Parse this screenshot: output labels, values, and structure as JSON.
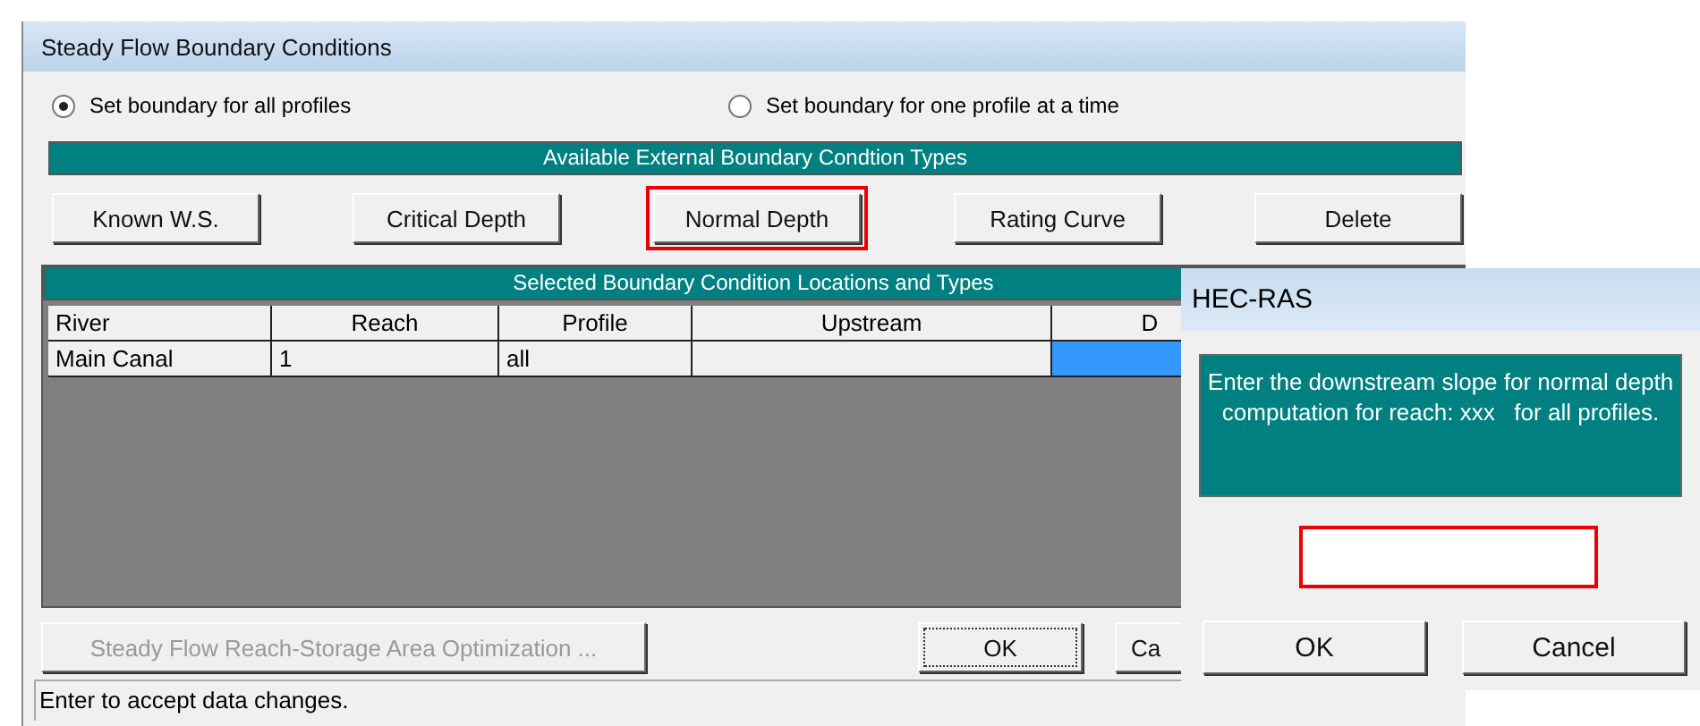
{
  "window": {
    "title": "Steady Flow Boundary Conditions"
  },
  "mode_options": [
    {
      "label": "Set boundary for all profiles",
      "selected": true
    },
    {
      "label": "Set boundary for one profile at a time",
      "selected": false
    }
  ],
  "types_header": "Available External Boundary Condtion Types",
  "type_buttons": [
    {
      "label": "Known W.S.",
      "highlighted": false
    },
    {
      "label": "Critical Depth",
      "highlighted": false
    },
    {
      "label": "Normal Depth",
      "highlighted": true
    },
    {
      "label": "Rating Curve",
      "highlighted": false
    },
    {
      "label": "Delete",
      "highlighted": false
    }
  ],
  "table": {
    "title": "Selected Boundary Condition Locations and Types",
    "columns": [
      "River",
      "Reach",
      "Profile",
      "Upstream",
      "D"
    ],
    "rows": [
      {
        "cells": [
          {
            "text": "Main Canal",
            "selected": false
          },
          {
            "text": "1",
            "selected": false
          },
          {
            "text": "all",
            "selected": false
          },
          {
            "selected": false
          },
          {
            "selected": true
          }
        ]
      }
    ]
  },
  "optimization_button": {
    "label": "Steady Flow Reach-Storage Area Optimization ...",
    "disabled": true
  },
  "ok_button": "OK",
  "cancel_button": "Ca",
  "status_bar": "Enter to accept data changes.",
  "dialog": {
    "title": "HEC-RAS",
    "message": "Enter the downstream slope for normal depth computation for reach: xxx   for all profiles.",
    "input": {
      "highlighted": true
    },
    "buttons": [
      "OK",
      "Cancel"
    ]
  }
}
